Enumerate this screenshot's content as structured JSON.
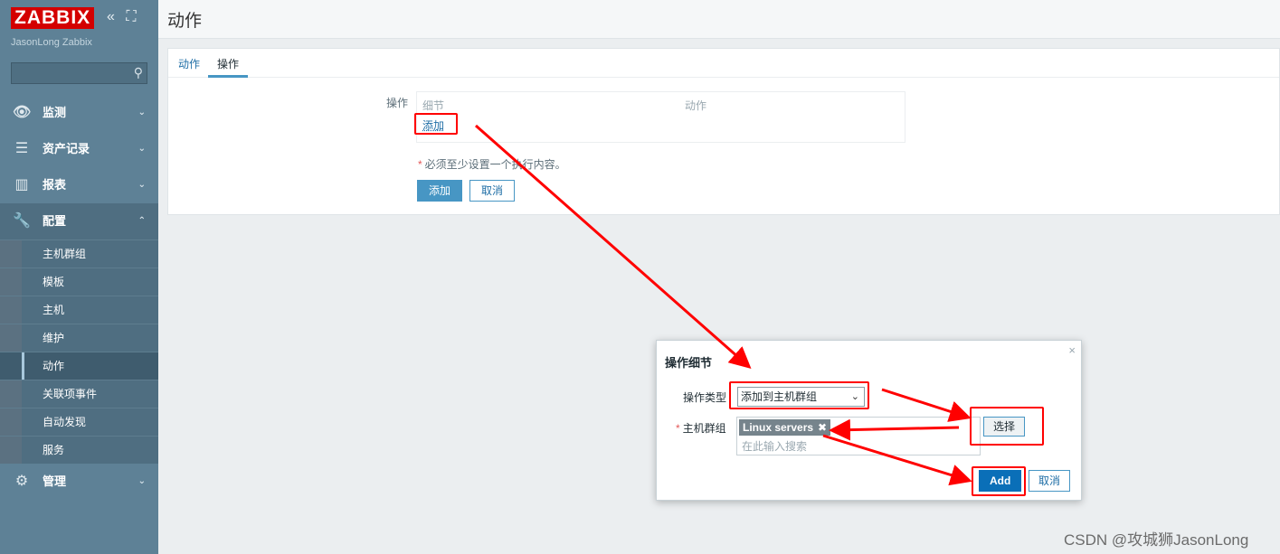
{
  "sidebar": {
    "logo": "ZABBIX",
    "collapse_icon": "«",
    "fullscreen_icon": "⛶",
    "server_name": "JasonLong Zabbix",
    "search_placeholder": "",
    "menu": [
      {
        "label": "监测",
        "icon": "eye-icon"
      },
      {
        "label": "资产记录",
        "icon": "list-icon"
      },
      {
        "label": "报表",
        "icon": "bar-chart-icon"
      },
      {
        "label": "配置",
        "icon": "wrench-icon"
      },
      {
        "label": "管理",
        "icon": "gear-icon"
      }
    ],
    "config_submenu": [
      "主机群组",
      "模板",
      "主机",
      "维护",
      "动作",
      "关联项事件",
      "自动发现",
      "服务"
    ]
  },
  "header": {
    "title": "动作"
  },
  "tabs": [
    "动作",
    "操作"
  ],
  "operations": {
    "label": "操作",
    "col_details": "细节",
    "col_action": "动作",
    "add_link": "添加",
    "note": "必须至少设置一个执行内容。",
    "add_button": "添加",
    "cancel_button": "取消"
  },
  "dialog": {
    "title": "操作细节",
    "close": "×",
    "type_label": "操作类型",
    "type_value": "添加到主机群组",
    "group_label": "主机群组",
    "chip": "Linux servers",
    "chip_remove": "✖",
    "search_placeholder": "在此输入搜索",
    "select_button": "选择",
    "add_button": "Add",
    "cancel_button": "取消"
  },
  "watermark": "CSDN @攻城狮JasonLong",
  "colors": {
    "accent": "#4796c4",
    "annotation": "#ff0000",
    "sidebar": "#5e8196",
    "logo_bg": "#d40000"
  }
}
